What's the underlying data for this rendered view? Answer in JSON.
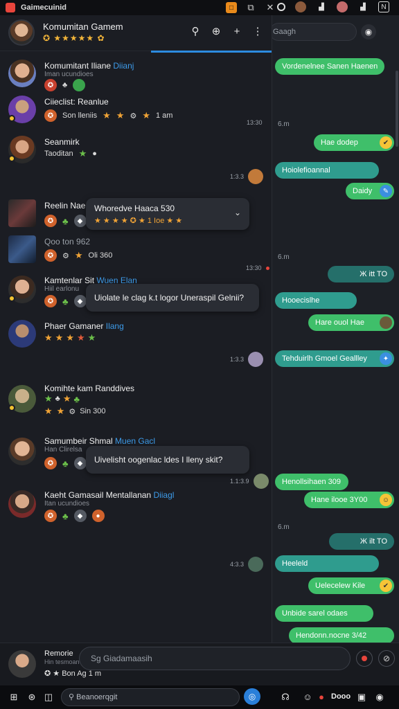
{
  "window": {
    "title": "Gaimecuinid",
    "controls": [
      "□",
      "✕"
    ]
  },
  "status_bar": {
    "icons": [
      "circle-icon",
      "avatar-icon",
      "signal-icon",
      "avatar-icon",
      "signal-icon",
      "nfc-icon",
      "close-icon"
    ]
  },
  "header": {
    "group_name": "Komumitan Gamem",
    "stars": "✪ ★★★★★ ✿"
  },
  "contacts": [
    {
      "name": "Komumitant Iliane",
      "tag": "Diianj",
      "sub": "Iman ucundioes",
      "row": [
        "✪",
        "♣",
        "●"
      ]
    },
    {
      "name": "Ciieclist: Reanlue",
      "tag": "",
      "sub": "",
      "row_text": "Son lleniis",
      "row_end": "1 am"
    },
    {
      "name": "Seanmirk",
      "tag": "",
      "sub": "",
      "sub2": "Taoditan"
    },
    {
      "name": "Reelin Nae",
      "tag": "",
      "sub": "",
      "row_end": "1 Ioe"
    },
    {
      "name": "Qoo ton 962",
      "tag": "",
      "sub": "",
      "row_end": "Oli 360"
    },
    {
      "name": "Kamtenlar Sit",
      "tag": "Wuen Elan",
      "sub": "Hiil earlonu"
    },
    {
      "name": "Phaer Gamaner",
      "tag": "Ilang",
      "sub": ""
    },
    {
      "name": "Komihte kam Randdives",
      "tag": "",
      "sub": "",
      "row_end": "Sin 300"
    },
    {
      "name": "Samumbeir Shmal",
      "tag": "Muen Gacl",
      "sub": "Han Clirelsa"
    },
    {
      "name": "Kaeht Gamasail Mentallanan",
      "tag": "Diiagl",
      "sub": "Itan ucundioes"
    }
  ],
  "popups": [
    {
      "title": "Whoredve Haaca 530",
      "meta": "★ ★ ★ ★ ✪ ★ 1 Ioe ★ ★"
    },
    {
      "text": "Uiolate le clag k.t logor Uneraspil Gelnii?"
    },
    {
      "text": "Uivelisht oogenlac ldes I lleny skit?"
    }
  ],
  "left_times": [
    "13:30",
    "1:3.3",
    "13:30",
    "1:3.3",
    "1.1:3.9",
    "4:3.3"
  ],
  "right": {
    "search_placeholder": "Gaagh",
    "times": [
      "6.m",
      "6.m",
      "6.m"
    ],
    "bubbles": [
      "Vordenelnee Sanen Haenen",
      "Hae dodep",
      "Hoiolefioannal",
      "Daidy",
      "Ж itt TO",
      "Hooecislhe",
      "Hare ouol Hae",
      "Tehduirlh Gmoel Geallley",
      "Henollsihaen 309",
      "Hane ilooe 3Y00",
      "Ж ilt TO",
      "Heeleld",
      "Uelecelew Kile",
      "Unbide sarel odaes",
      "Hendonn.nocne 3/42"
    ]
  },
  "composer": {
    "name": "Remorie",
    "sub": "Hin tesmoan",
    "row": "✪ ★ Bon Ag 1 m",
    "placeholder": "Sg Giadamaasih"
  },
  "taskbar": {
    "search": "Beanoerqgit",
    "text": "Dooo"
  }
}
